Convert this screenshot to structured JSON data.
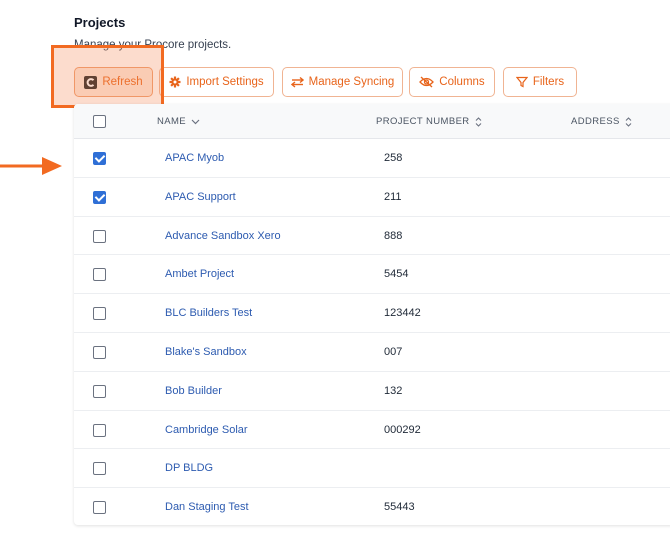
{
  "header": {
    "title": "Projects",
    "subtitle": "Manage your Procore projects."
  },
  "toolbar": {
    "refresh_label": "Refresh",
    "import_settings_label": "Import Settings",
    "manage_syncing_label": "Manage Syncing",
    "columns_label": "Columns",
    "filters_label": "Filters"
  },
  "table": {
    "columns": [
      "NAME",
      "PROJECT NUMBER",
      "ADDRESS"
    ],
    "rows": [
      {
        "name": "APAC Myob",
        "number": "258",
        "checked": true
      },
      {
        "name": "APAC Support",
        "number": "211",
        "checked": true
      },
      {
        "name": "Advance Sandbox Xero",
        "number": "888",
        "checked": false
      },
      {
        "name": "Ambet Project",
        "number": "5454",
        "checked": false
      },
      {
        "name": "BLC Builders Test",
        "number": "123442",
        "checked": false
      },
      {
        "name": "Blake's Sandbox",
        "number": "007",
        "checked": false
      },
      {
        "name": "Bob Builder",
        "number": "132",
        "checked": false
      },
      {
        "name": "Cambridge Solar",
        "number": "000292",
        "checked": false
      },
      {
        "name": "DP BLDG",
        "number": "",
        "checked": false
      },
      {
        "name": "Dan Staging Test",
        "number": "55443",
        "checked": false
      }
    ]
  },
  "colors": {
    "accent": "#e8641b",
    "highlight": "#f26a21",
    "link": "#2d5bb0",
    "checkbox": "#2f6fd6"
  }
}
